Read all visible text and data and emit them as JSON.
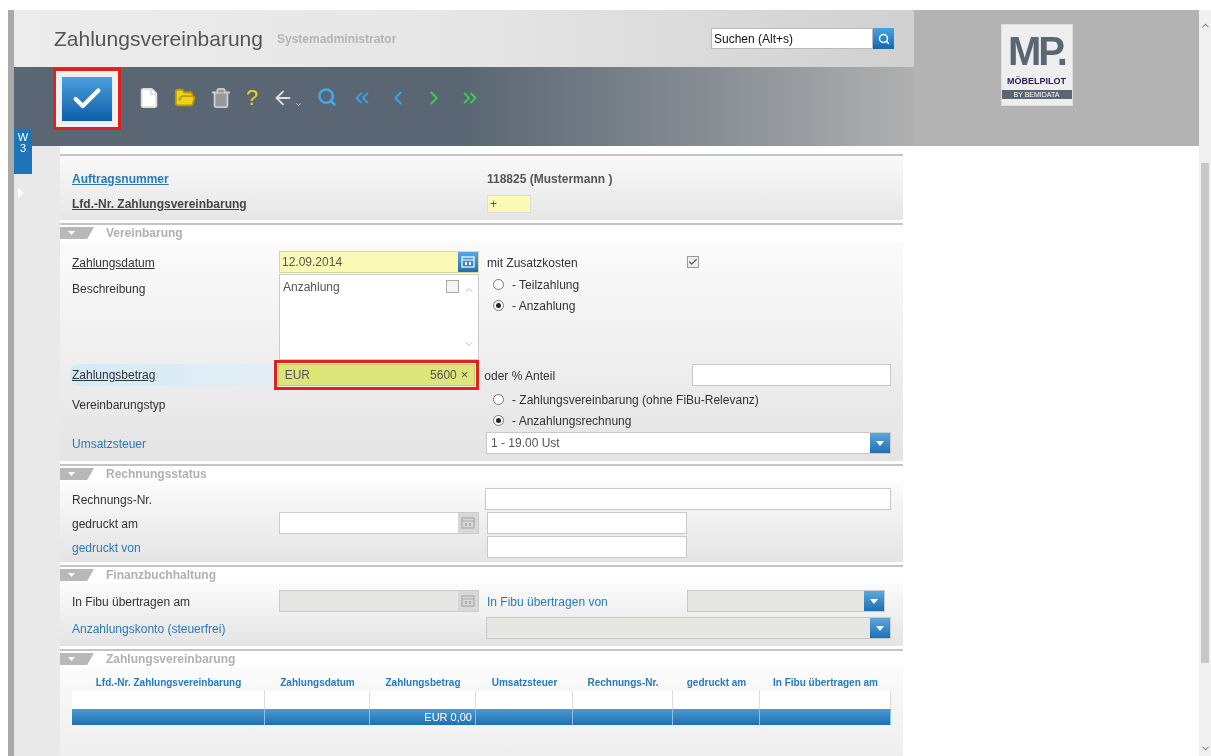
{
  "header": {
    "title": "Zahlungsvereinbarung",
    "user": "Systemadministrator",
    "search": {
      "placeholder": "Suchen (Alt+s)"
    },
    "logo": {
      "mark": "MP.",
      "name": "MÖBELPILOT",
      "byline": "BY BEMIDATA"
    }
  },
  "toolbar": [
    {
      "kind": "save",
      "highlighted": true
    },
    {
      "kind": "new"
    },
    {
      "kind": "open"
    },
    {
      "kind": "delete"
    },
    {
      "kind": "help",
      "glyph": "?"
    },
    {
      "kind": "back"
    },
    {
      "kind": "search"
    },
    {
      "kind": "first"
    },
    {
      "kind": "prev"
    },
    {
      "kind": "next"
    },
    {
      "kind": "last"
    }
  ],
  "side_tab": {
    "lines": [
      "W",
      "3"
    ]
  },
  "head_fields": [
    {
      "label": "Auftragsnummer",
      "value": "118825 (Mustermann )",
      "kind": "text"
    },
    {
      "label": "Lfd.-Nr. Zahlungsvereinbarung",
      "value": "+",
      "kind": "input"
    }
  ],
  "vereinbarung": {
    "title": "Vereinbarung",
    "zahlungsdatum": {
      "label": "Zahlungsdatum",
      "value": "12.09.2014"
    },
    "zusatzkosten": {
      "label": "mit Zusatzkosten",
      "checked": true
    },
    "beschreibung": {
      "label": "Beschreibung",
      "value": "Anzahlung",
      "checked": false
    },
    "zahlungsart": [
      {
        "label": "- Teilzahlung",
        "selected": false
      },
      {
        "label": "- Anzahlung",
        "selected": true
      }
    ],
    "betrag": {
      "label": "Zahlungsbetrag",
      "currency": "EUR",
      "value": "5600",
      "clear": "×",
      "highlighted": true,
      "focused": true
    },
    "anteil": {
      "label": "oder % Anteil"
    },
    "typ": {
      "label": "Vereinbarungstyp",
      "options": [
        {
          "label": "- Zahlungsvereinbarung (ohne FiBu-Relevanz)",
          "selected": false
        },
        {
          "label": "- Anzahlungsrechnung",
          "selected": true
        }
      ]
    },
    "umsatzsteuer": {
      "label": "Umsatzsteuer",
      "value": "1 - 19.00 Ust"
    }
  },
  "rechnungsstatus": {
    "title": "Rechnungsstatus",
    "nr": {
      "label": "Rechnungs-Nr."
    },
    "gedruckt_am": {
      "label": "gedruckt am"
    },
    "gedruckt_von": {
      "label": "gedruckt von"
    }
  },
  "fibu": {
    "title": "Finanzbuchhaltung",
    "am": {
      "label": "In Fibu übertragen am",
      "disabled": true
    },
    "von": {
      "label": "In Fibu übertragen von",
      "disabled": true
    },
    "konto": {
      "label": "Anzahlungskonto (steuerfrei)",
      "disabled": true
    }
  },
  "table": {
    "title": "Zahlungsvereinbarung",
    "columns": [
      "Lfd.-Nr. Zahlungsvereinbarung",
      "Zahlungsdatum",
      "Zahlungsbetrag",
      "Umsatzsteuer",
      "Rechnungs-Nr.",
      "gedruckt am",
      "In Fibu übertragen am"
    ],
    "total": {
      "amount": "EUR 0,00"
    }
  }
}
